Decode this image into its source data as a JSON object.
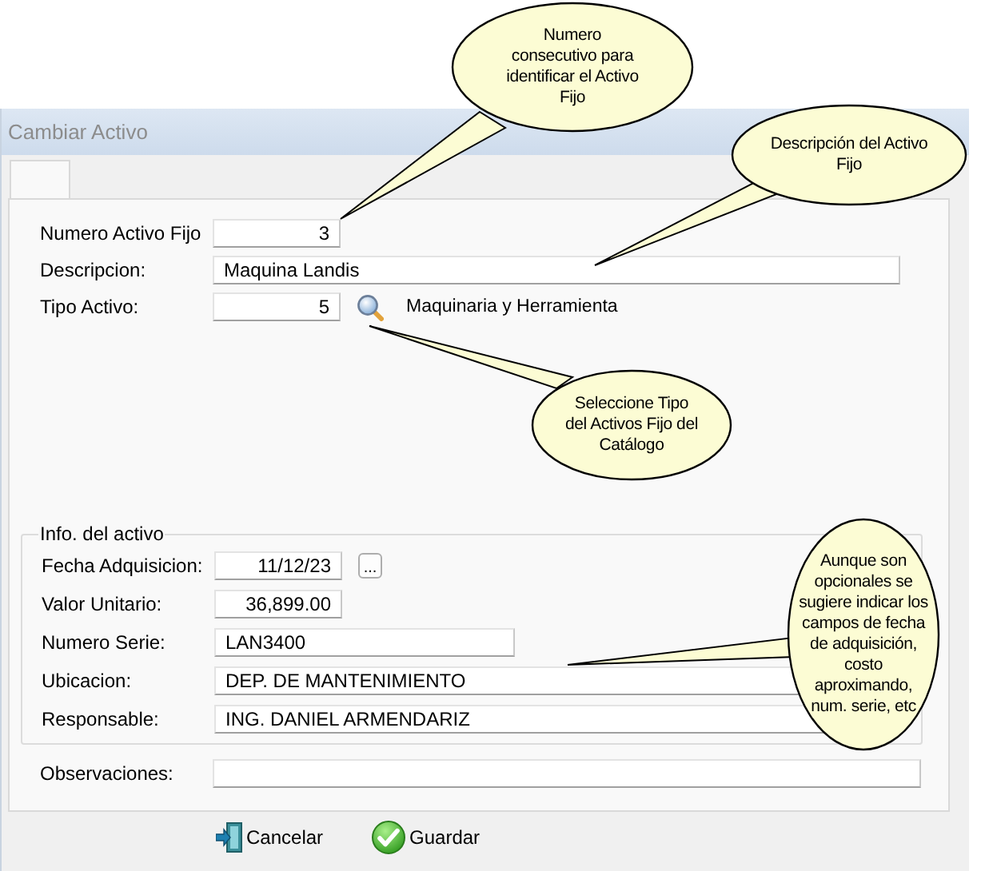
{
  "window": {
    "title": "Cambiar Activo"
  },
  "general": [
    {
      "label": "Numero Activo Fijo",
      "value": "3",
      "kind": "number"
    },
    {
      "label": "Descripcion:",
      "value": "Maquina Landis",
      "kind": "text"
    },
    {
      "label": "Tipo Activo:",
      "value": "5",
      "kind": "number",
      "lookup": "Maquinaria y Herramienta"
    }
  ],
  "asset_info": {
    "title": "Info. del activo",
    "fields": [
      {
        "label": "Fecha Adquisicion:",
        "value": "11/12/23",
        "kind": "number",
        "picker": "..."
      },
      {
        "label": "Valor Unitario:",
        "value": "36,899.00",
        "kind": "number"
      },
      {
        "label": "Numero Serie:",
        "value": "LAN3400",
        "kind": "code"
      },
      {
        "label": "Ubicacion:",
        "value": "DEP. DE MANTENIMIENTO",
        "kind": "text"
      },
      {
        "label": "Responsable:",
        "value": "ING. DANIEL ARMENDARIZ",
        "kind": "text"
      }
    ]
  },
  "observaciones": {
    "label": "Observaciones:"
  },
  "buttons": [
    {
      "label": "Cancelar",
      "kind": "cancel"
    },
    {
      "label": "Guardar",
      "kind": "save"
    }
  ],
  "callouts": [
    {
      "text": "Numero consecutivo para identificar el Activo Fijo"
    },
    {
      "text": "Descripción del Activo Fijo"
    },
    {
      "text": "Seleccione Tipo del Activos Fijo del Catálogo"
    },
    {
      "text": "Aunque son opcionales se sugiere indicar los campos de fecha de adquisición, costo aproximando, num. serie, etc"
    }
  ]
}
